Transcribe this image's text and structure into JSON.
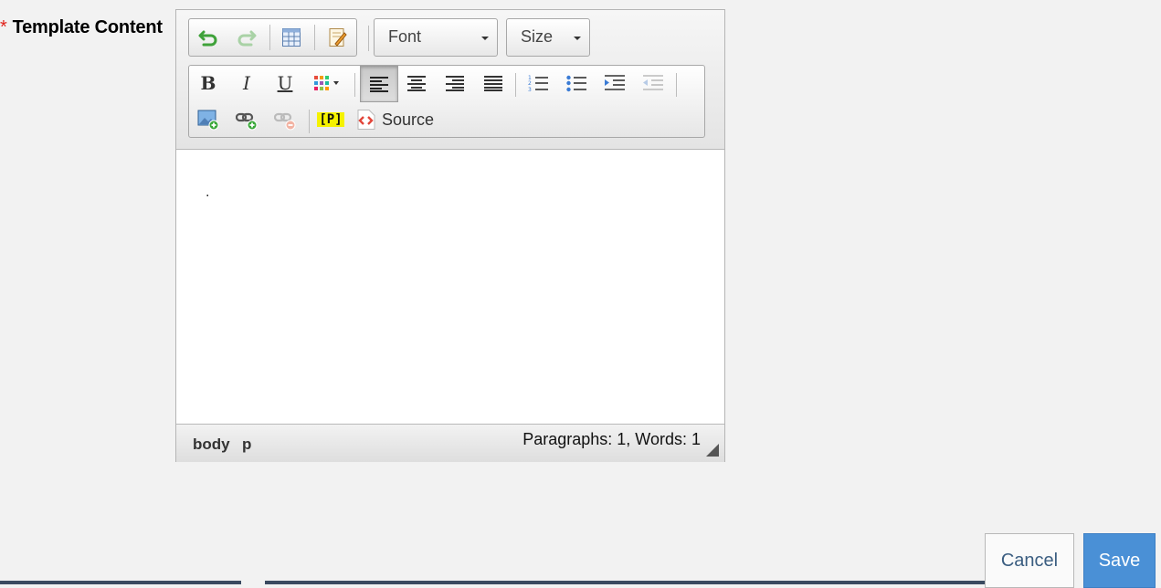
{
  "field": {
    "required_mark": "*",
    "label": "Template Content"
  },
  "toolbar": {
    "font_label": "Font",
    "size_label": "Size",
    "source_label": "Source",
    "placeholder_button_text": "[P]"
  },
  "editor": {
    "content_text": "."
  },
  "status": {
    "path": [
      "body",
      "p"
    ],
    "count_text": "Paragraphs: 1, Words: 1"
  },
  "actions": {
    "cancel_label": "Cancel",
    "save_label": "Save"
  },
  "colors": {
    "required": "#e0221b",
    "save_bg": "#4a90d6",
    "cancel_text": "#3a5d80"
  }
}
